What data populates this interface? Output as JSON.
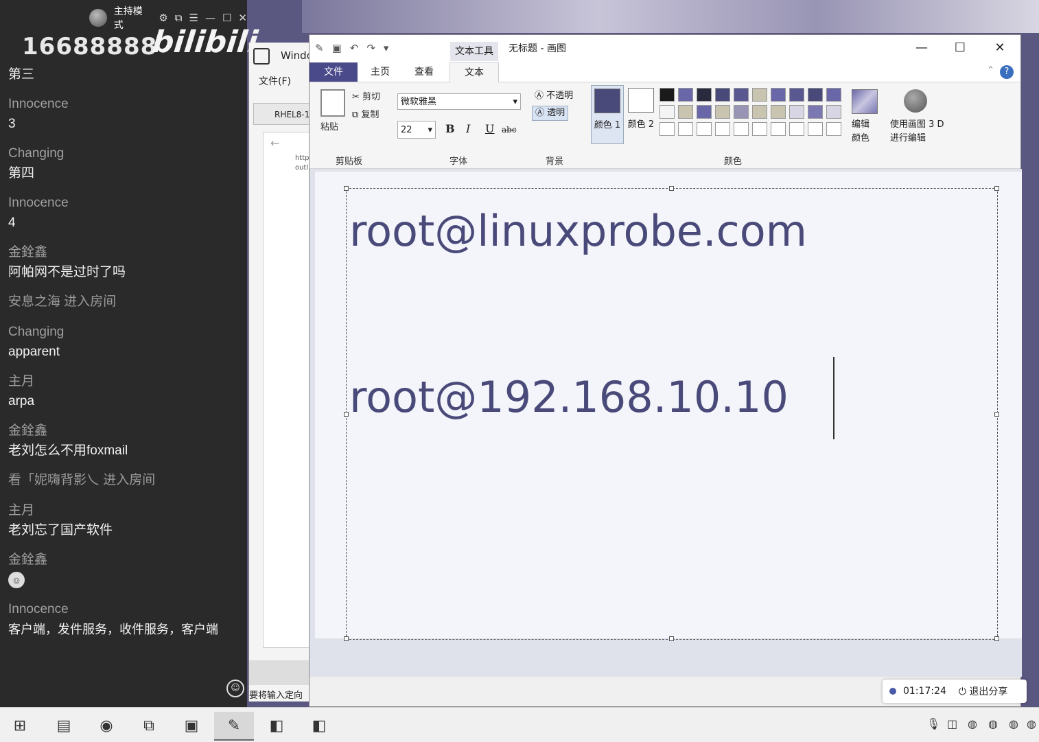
{
  "chat": {
    "mode_label": "主持模式",
    "room_id": "16688888",
    "logo_text": "bilibili",
    "messages": [
      {
        "name": "",
        "text": "第三"
      },
      {
        "name": "Innocence",
        "text": "3"
      },
      {
        "name": "Changing",
        "text": "第四"
      },
      {
        "name": "Innocence",
        "text": "4"
      },
      {
        "name": "金銓鑫",
        "text": "阿帕网不是过时了吗"
      },
      {
        "name": "安息之海 进入房间",
        "text": ""
      },
      {
        "name": "Changing",
        "text": "apparent"
      },
      {
        "name": "主月",
        "text": "arpa"
      },
      {
        "name": "金銓鑫",
        "text": "老刘怎么不用foxmail"
      },
      {
        "name": "看「妮嗨背影乀 进入房间",
        "text": ""
      },
      {
        "name": "主月",
        "text": "老刘忘了国产软件"
      },
      {
        "name": "金銓鑫",
        "text": "",
        "emoji": "grinning-face"
      },
      {
        "name": "Innocence",
        "text": "客户端，发件服务，收件服务，客户端"
      }
    ]
  },
  "back_window": {
    "title": "Windo",
    "menu_file": "文件(F)",
    "tab_label": "RHEL8-1",
    "url_line1": "http",
    "url_line2": "outl",
    "input_placeholder": "要将输入定向"
  },
  "paint": {
    "context_tab": "文本工具",
    "doc_title": "无标题 - 画图",
    "tabs": [
      "文件",
      "主页",
      "查看",
      "文本"
    ],
    "active_tab": "文本",
    "clipboard": {
      "paste": "粘贴",
      "cut": "剪切",
      "copy": "复制",
      "group": "剪贴板"
    },
    "font": {
      "family": "微软雅黑",
      "size": "22",
      "group": "字体",
      "bold": "B",
      "italic": "I",
      "underline": "U",
      "strike": "abc"
    },
    "background": {
      "opaque": "不透明",
      "transparent": "透明",
      "group": "背景"
    },
    "colors": {
      "color1_label": "颜色 1",
      "color2_label": "颜色 2",
      "color1": "#4a4a7a",
      "color2": "#ffffff",
      "edit_colors": "编辑颜色",
      "paint3d": "使用画图 3 D 进行编辑",
      "group": "颜色",
      "palette": [
        "#1a1a1a",
        "#6a67a8",
        "#2a2a3e",
        "#4a4a7a",
        "#5a5890",
        "#c8c4b0",
        "#6a67a8",
        "#5a5890",
        "#4a4a7a",
        "#6a67a8",
        "#f4f4f4",
        "#c8c4b0",
        "#6a67a8",
        "#c8c4b0",
        "#9894b4",
        "#c8c4b0",
        "#c8c4b0",
        "#d8d6e2",
        "#7a77b2",
        "#d8d6e2",
        "#ffffff",
        "#ffffff",
        "#ffffff",
        "#ffffff",
        "#ffffff",
        "#ffffff",
        "#ffffff",
        "#ffffff",
        "#ffffff",
        "#ffffff"
      ]
    },
    "canvas_text": [
      "root@linuxprobe.com",
      "root@192.168.10.10"
    ]
  },
  "share": {
    "timer": "01:17:24",
    "exit_label": "退出分享"
  },
  "taskbar": {
    "items": [
      "windows-start",
      "file-explorer",
      "chrome",
      "vm-manager",
      "media-player",
      "paint",
      "vm-window-1",
      "vm-window-2"
    ]
  }
}
